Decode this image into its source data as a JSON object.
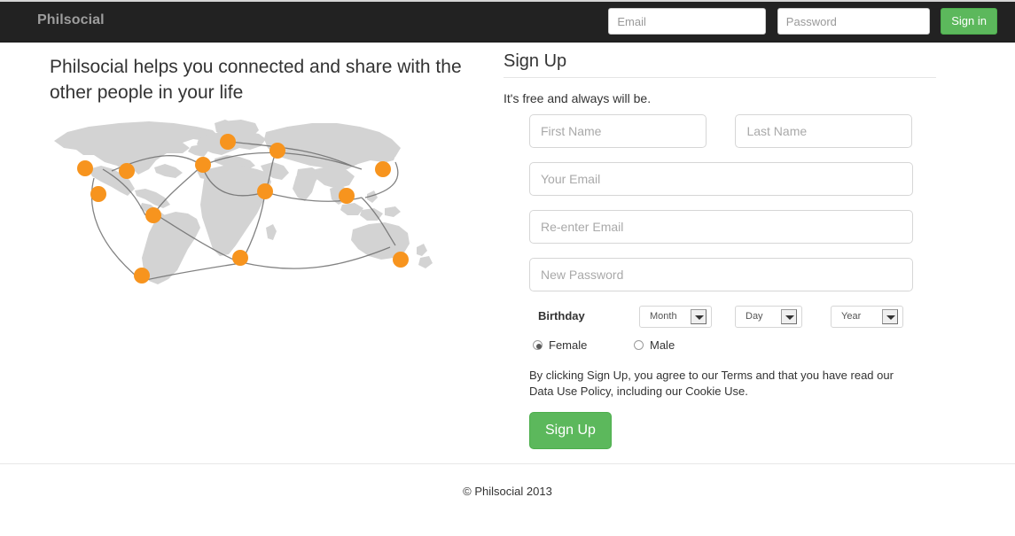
{
  "navbar": {
    "brand": "Philsocial",
    "email_placeholder": "Email",
    "password_placeholder": "Password",
    "signin_label": "Sign in"
  },
  "hero": {
    "headline": "Philsocial helps you connected and share with the other people in your life",
    "map_alt": "world-connections-map"
  },
  "signup": {
    "title": "Sign Up",
    "subtitle": "It's free and always will be.",
    "first_name_placeholder": "First Name",
    "last_name_placeholder": "Last Name",
    "email_placeholder": "Your Email",
    "reenter_email_placeholder": "Re-enter Email",
    "password_placeholder": "New Password",
    "birthday_label": "Birthday",
    "month_selected": "Month",
    "day_selected": "Day",
    "year_selected": "Year",
    "gender_female": "Female",
    "gender_male": "Male",
    "gender_selected": "Female",
    "terms_text": "By clicking Sign Up, you agree to our Terms and that you have read our Data Use Policy, including our Cookie Use.",
    "submit_label": "Sign Up"
  },
  "footer": {
    "copyright": "© Philsocial 2013"
  },
  "colors": {
    "navbar_bg": "#222222",
    "brand_text": "#9d9d9d",
    "green_button": "#5cb85c",
    "map_land": "#d3d3d3",
    "map_dot": "#f7941e",
    "map_arc": "#6d6d6d",
    "input_border": "#d6d6d6"
  }
}
